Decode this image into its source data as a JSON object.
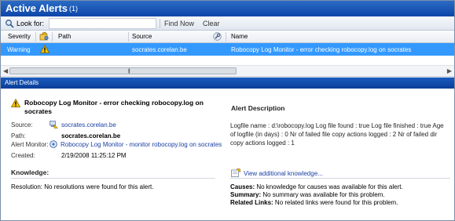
{
  "window": {
    "title": "Active Alerts",
    "count": "(1)"
  },
  "toolbar": {
    "look_for_label": "Look for:",
    "search_value": "",
    "find_now_label": "Find Now",
    "clear_label": "Clear"
  },
  "grid": {
    "columns": {
      "severity": "Severity",
      "path": "Path",
      "source": "Source",
      "name": "Name"
    },
    "row": {
      "severity": "Warning",
      "path": "",
      "source": "socrates.corelan.be",
      "name": "Robocopy Log Monitor - error checking robocopy.log on socrates"
    }
  },
  "details": {
    "header": "Alert Details",
    "alert_title": "Robocopy Log Monitor - error checking robocopy.log on socrates",
    "source_label": "Source:",
    "source_value": "socrates.corelan.be",
    "path_label": "Path:",
    "path_value": "socrates.corelan.be",
    "monitor_label": "Alert Monitor:",
    "monitor_value": "Robocopy Log Monitor - monitor robocopy.log on socrates",
    "created_label": "Created:",
    "created_value": "2/19/2008 11:25:12 PM",
    "description_title": "Alert Description",
    "description_text": "Logfile name : d:\\robocopy.log Log file found : true Log file finished : true Age of logfile (in days) : 0 Nr of failed file copy actions logged : 2 Nr of failed dir copy actions logged : 1",
    "knowledge_title": "Knowledge:",
    "view_knowledge_link": "View additional knowledge...",
    "resolution_label": "Resolution:",
    "resolution_text": "No resolutions were found for this alert.",
    "causes_label": "Causes:",
    "causes_text": "No knowledge for causes was available for this alert.",
    "summary_label": "Summary:",
    "summary_text": "No summary was available for this problem.",
    "related_label": "Related Links:",
    "related_text": "No related links were found for this problem."
  },
  "colors": {
    "title_bar": "#0d46a8",
    "selected_row": "#3399ff",
    "link": "#1a3fa3",
    "warning": "#f5c400"
  }
}
